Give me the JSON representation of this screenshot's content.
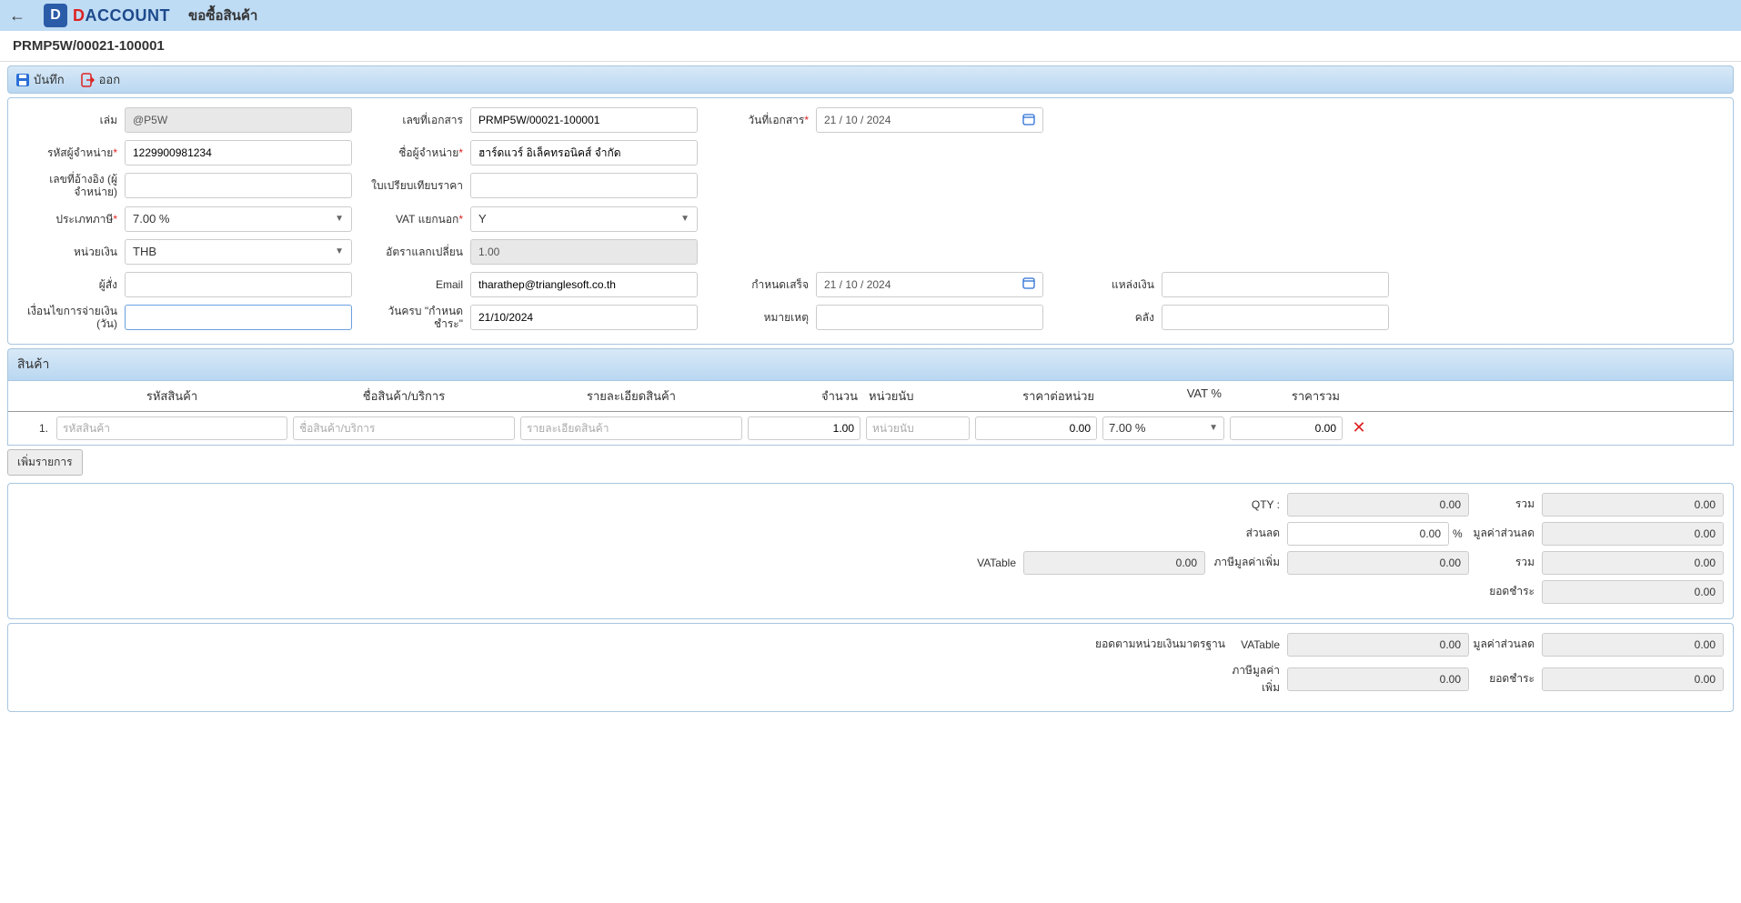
{
  "header": {
    "brand_d": "D",
    "brand_rest": "ACCOUNT",
    "page_title": "ขอซื้อสินค้า"
  },
  "doc_number": "PRMP5W/00021-100001",
  "toolbar": {
    "save": "บันทึก",
    "exit": "ออก"
  },
  "labels": {
    "book": "เล่ม",
    "doc_no": "เลขที่เอกสาร",
    "doc_date": "วันที่เอกสาร",
    "vendor_code": "รหัสผู้จำหน่าย",
    "vendor_name": "ชื่อผู้จำหน่าย",
    "ref_no": "เลขที่อ้างอิง (ผู้จำหน่าย)",
    "quotation": "ใบเปรียบเทียบราคา",
    "tax_type": "ประเภทภาษี",
    "vat_sep": "VAT แยกนอก",
    "currency": "หน่วยเงิน",
    "exch_rate": "อัตราแลกเปลี่ยน",
    "orderer": "ผู้สั่ง",
    "email": "Email",
    "due_date": "กำหนดเสร็จ",
    "source": "แหล่งเงิน",
    "credit_days": "เงื่อนไขการจ่ายเงิน (วัน)",
    "payment_due": "วันครบ \"กำหนดชำระ\"",
    "remark": "หมายเหตุ",
    "warehouse": "คลัง"
  },
  "form": {
    "book": "@P5W",
    "doc_no": "PRMP5W/00021-100001",
    "doc_date": "21 / 10 / 2024",
    "vendor_code": "1229900981234",
    "vendor_name": "ฮาร์ดแวร์ อิเล็คทรอนิคส์ จำกัด",
    "ref_no": "",
    "quotation": "",
    "tax_type": "7.00 %",
    "vat_sep": "Y",
    "currency": "THB",
    "exch_rate": "1.00",
    "orderer": "",
    "email": "tharathep@trianglesoft.co.th",
    "due_date": "21 / 10 / 2024",
    "source": "",
    "credit_days": "",
    "payment_due": "21/10/2024",
    "remark": "",
    "warehouse": ""
  },
  "grid": {
    "section_title": "สินค้า",
    "headers": {
      "code": "รหัสสินค้า",
      "name": "ชื่อสินค้า/บริการ",
      "desc": "รายละเอียดสินค้า",
      "qty": "จำนวน",
      "unit": "หน่วยนับ",
      "price": "ราคาต่อหน่วย",
      "vat": "VAT %",
      "total": "ราคารวม"
    },
    "row1": {
      "idx": "1.",
      "code_ph": "รหัสสินค้า",
      "name_ph": "ชื่อสินค้า/บริการ",
      "desc_ph": "รายละเอียดสินค้า",
      "qty": "1.00",
      "unit_ph": "หน่วยนับ",
      "price": "0.00",
      "vat": "7.00 %",
      "total": "0.00"
    },
    "add_btn": "เพิ่มรายการ"
  },
  "totals1": {
    "qty_label": "QTY :",
    "qty": "0.00",
    "sum_label": "รวม",
    "sum": "0.00",
    "discount_label": "ส่วนลด",
    "discount": "0.00",
    "discount_pct": "%",
    "disc_val_label": "มูลค่าส่วนลด",
    "disc_val": "0.00",
    "vatable_label": "VATable",
    "vatable": "0.00",
    "vat_label": "ภาษีมูลค่าเพิ่ม",
    "vat": "0.00",
    "sum2_label": "รวม",
    "sum2": "0.00",
    "net_label": "ยอดชำระ",
    "net": "0.00"
  },
  "totals2": {
    "lead": "ยอดตามหน่วยเงินมาตรฐาน",
    "vatable_label": "VATable",
    "vatable": "0.00",
    "disc_val_label": "มูลค่าส่วนลด",
    "disc_val": "0.00",
    "vat_label": "ภาษีมูลค่าเพิ่ม",
    "vat": "0.00",
    "net_label": "ยอดชำระ",
    "net": "0.00"
  }
}
